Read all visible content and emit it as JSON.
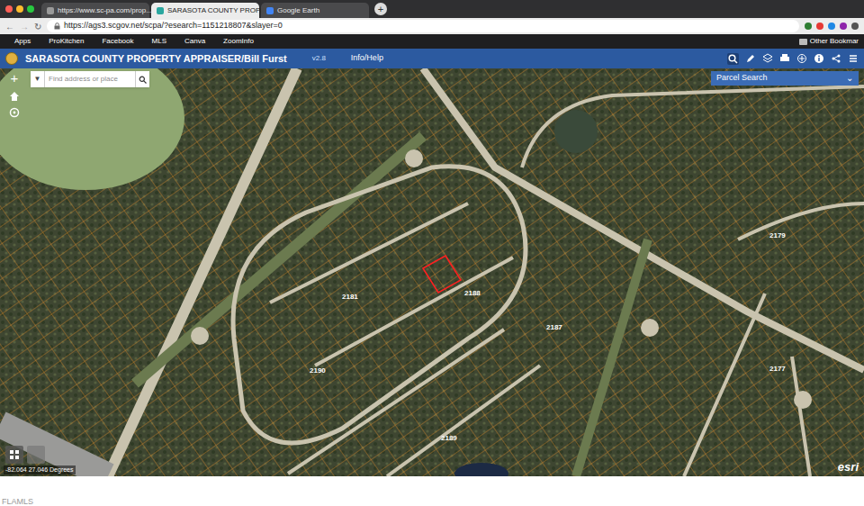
{
  "browser": {
    "tabs": [
      {
        "label": "https://www.sc-pa.com/prop...",
        "selected": false
      },
      {
        "label": "SARASOTA COUNTY PROPER...",
        "selected": true
      },
      {
        "label": "Google Earth",
        "selected": false
      }
    ],
    "new_tab": "+",
    "address": "https://ags3.scgov.net/scpa/?esearch=1151218807&slayer=0",
    "bookmarks": [
      "Apps",
      "ProKitchen",
      "Facebook",
      "MLS",
      "Canva",
      "ZoomInfo"
    ],
    "other_bookmarks": "Other Bookmar"
  },
  "app": {
    "title": "SARASOTA COUNTY PROPERTY APPRAISER/Bill Furst",
    "version": "v2.8",
    "menu": "Info/Help"
  },
  "search": {
    "placeholder": "Find address or place"
  },
  "panel": {
    "title": "Parcel Search",
    "toggle": "⌄"
  },
  "map": {
    "zoom_in": "+",
    "parcel_highlighted": true,
    "block_labels": [
      "2181",
      "2188",
      "2187",
      "2190",
      "2189",
      "2179",
      "2177"
    ],
    "coordinates": "-82.064 27.046 Degrees",
    "attribution": "esri"
  },
  "footer": "FLAMLS"
}
